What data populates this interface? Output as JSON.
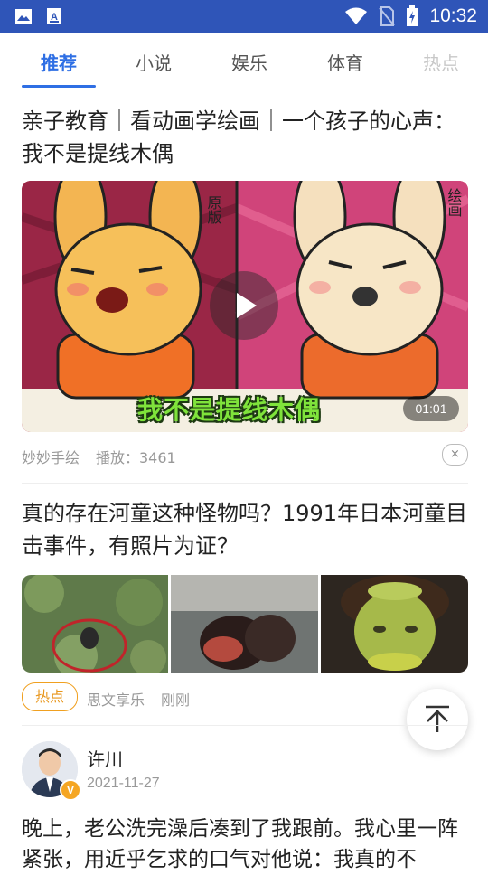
{
  "status_bar": {
    "time": "10:32",
    "icons": [
      "gallery-icon",
      "a-notification-icon",
      "wifi-icon",
      "no-sim-icon",
      "battery-charging-icon"
    ]
  },
  "tabs": [
    {
      "label": "推荐",
      "active": true
    },
    {
      "label": "小说",
      "active": false
    },
    {
      "label": "娱乐",
      "active": false
    },
    {
      "label": "体育",
      "active": false
    },
    {
      "label": "热点",
      "active": false
    }
  ],
  "article1": {
    "title": "亲子教育｜看动画学绘画｜一个孩子的心声：我不是提线木偶",
    "video": {
      "duration": "01:01",
      "overlay_text": "我不是提线木偶",
      "left_corner_label": "原版",
      "right_corner_label": "绘画"
    },
    "author": "妙妙手绘",
    "plays": "播放：3461",
    "close_symbol": "×"
  },
  "article2": {
    "title": "真的存在河童这种怪物吗？1991年日本河童目击事件，有照片为证？",
    "tag": "热点",
    "source": "思文享乐",
    "time": "刚刚"
  },
  "post": {
    "author_name": "许川",
    "date": "2021-11-27",
    "verified_badge": "V",
    "body": "晚上，老公洗完澡后凑到了我跟前。我心里一阵紧张，用近乎乞求的口气对他说：我真的不"
  },
  "colors": {
    "status_bar": "#2f55b8",
    "accent": "#2f6fe4",
    "hot_tag": "#e8961b",
    "video_overlay_text": "#7fe33b"
  }
}
